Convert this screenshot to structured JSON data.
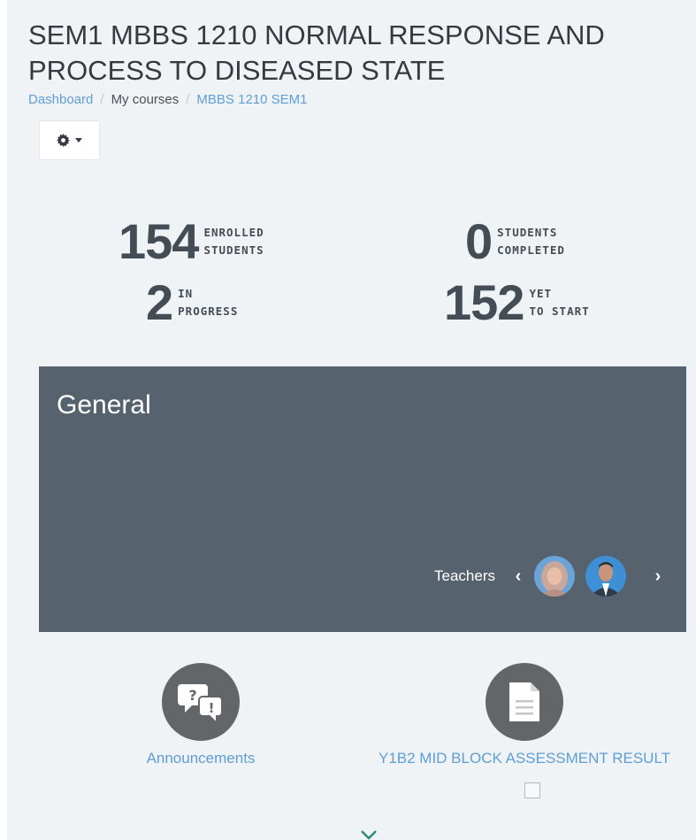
{
  "course": {
    "title": "SEM1 MBBS 1210 NORMAL RESPONSE AND PROCESS TO DISEASED STATE"
  },
  "breadcrumb": [
    "Dashboard",
    "My courses",
    "MBBS 1210 SEM1"
  ],
  "settings_icon": "gear-icon",
  "stats": {
    "enrolled": {
      "value": "154",
      "label_line1": "ENROLLED",
      "label_line2": "STUDENTS"
    },
    "completed": {
      "value": "0",
      "label_line1": "STUDENTS",
      "label_line2": "COMPLETED"
    },
    "in_progress": {
      "value": "2",
      "label_line1": "IN",
      "label_line2": "PROGRESS"
    },
    "yet_to_start": {
      "value": "152",
      "label_line1": "YET",
      "label_line2": "TO START"
    }
  },
  "section": {
    "title": "General",
    "background": "#56626d",
    "teachers_label": "Teachers",
    "teacher_count": 2
  },
  "activities": [
    {
      "label": "Announcements",
      "icon": "forum-icon"
    },
    {
      "label": "Y1B2 MID BLOCK ASSESSMENT RESULT",
      "icon": "file-icon"
    }
  ],
  "colors": {
    "link": "#5e9ed6",
    "page_bg": "#f0f3f5",
    "text": "#343a40"
  }
}
